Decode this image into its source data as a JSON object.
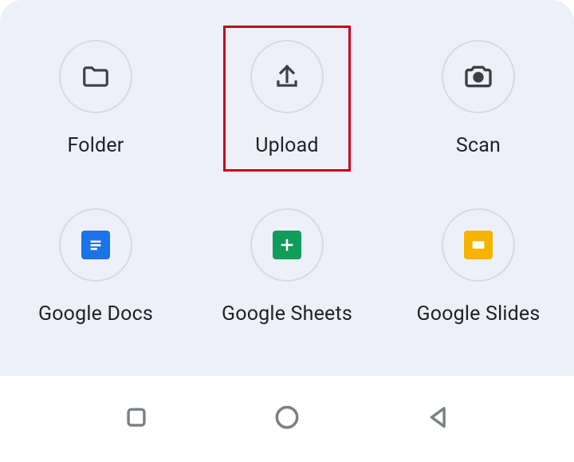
{
  "actions": [
    {
      "id": "folder",
      "label": "Folder",
      "icon": "folder-icon",
      "highlighted": false
    },
    {
      "id": "upload",
      "label": "Upload",
      "icon": "upload-icon",
      "highlighted": true
    },
    {
      "id": "scan",
      "label": "Scan",
      "icon": "camera-icon",
      "highlighted": false
    },
    {
      "id": "docs",
      "label": "Google Docs",
      "icon": "docs-icon",
      "highlighted": false
    },
    {
      "id": "sheets",
      "label": "Google Sheets",
      "icon": "sheets-icon",
      "highlighted": false
    },
    {
      "id": "slides",
      "label": "Google Slides",
      "icon": "slides-icon",
      "highlighted": false
    }
  ],
  "colors": {
    "sheet_bg": "#eef0f9",
    "circle_border": "#d7d9e3",
    "highlight": "#c4001a",
    "icon_dark": "#3c4043",
    "docs": "#1a73e8",
    "sheets": "#0f9d58",
    "slides": "#f4b400"
  }
}
